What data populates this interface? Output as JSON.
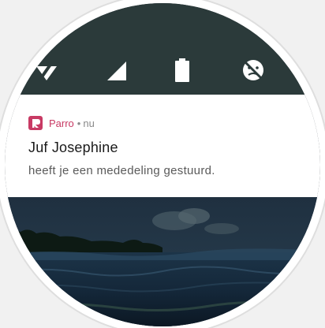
{
  "status_bar": {
    "icons": [
      "wifi-icon",
      "cellular-signal-icon",
      "battery-icon",
      "do-not-disturb-icon"
    ],
    "background": "#2b3a3a"
  },
  "notification": {
    "app_name": "Parro",
    "separator": "•",
    "time": "nu",
    "title": "Juf Josephine",
    "body": "heeft je een mededeling gestuurd.",
    "accent_color": "#c83a64"
  },
  "wallpaper": {
    "subject": "ocean-waves-night-image"
  }
}
